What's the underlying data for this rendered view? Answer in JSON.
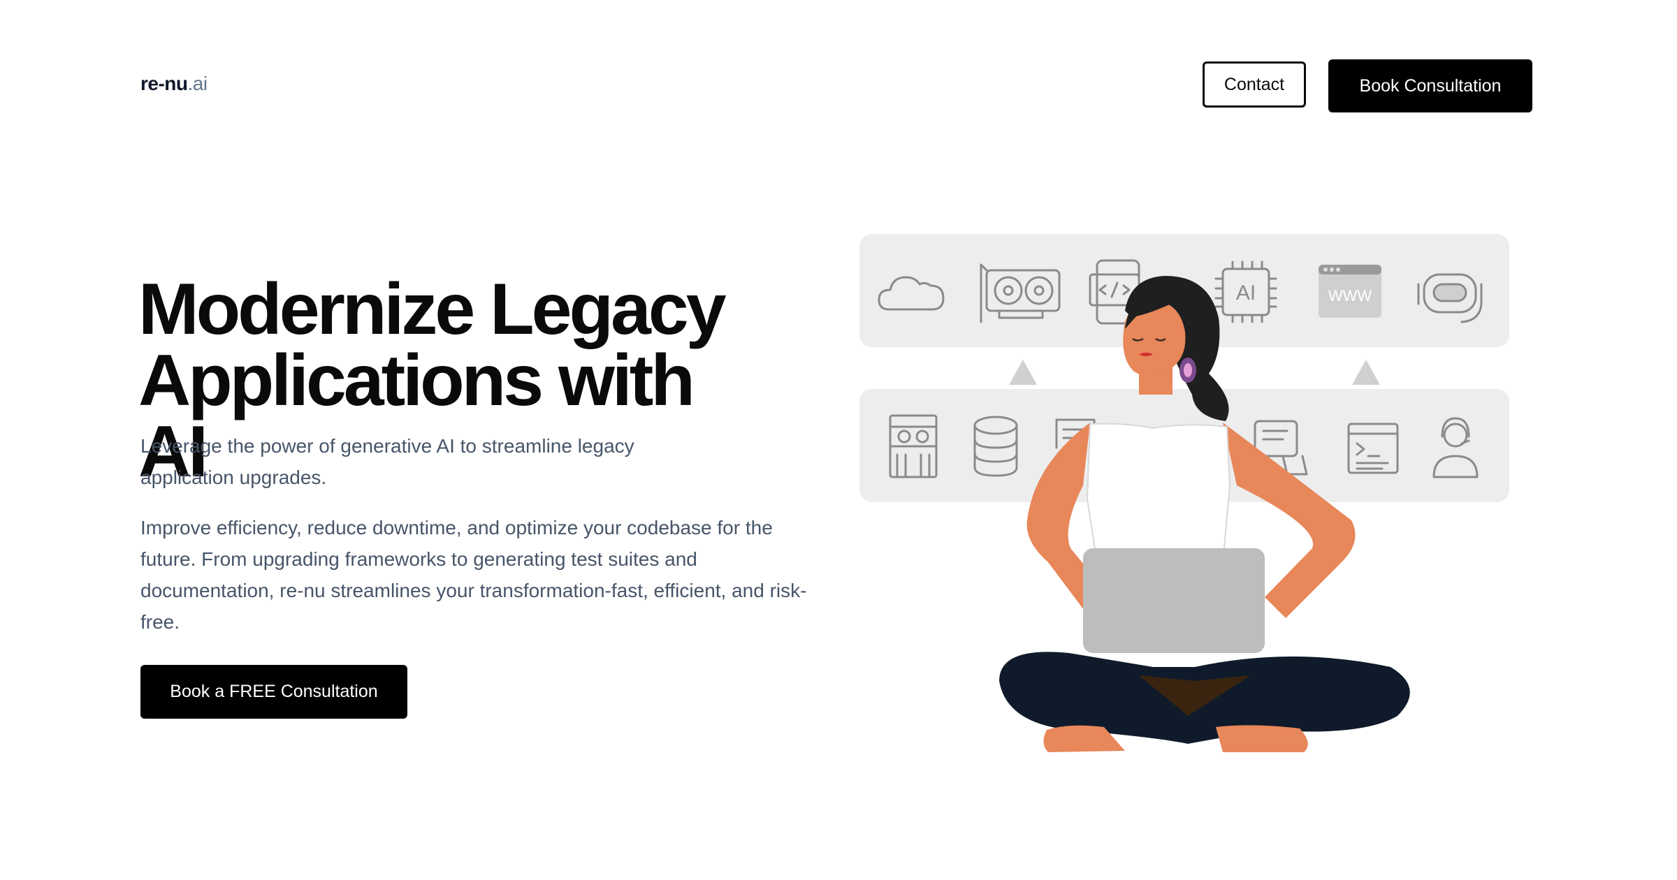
{
  "header": {
    "logo_main": "re-nu",
    "logo_suffix": ".ai",
    "contact_label": "Contact",
    "book_label": "Book Consultation"
  },
  "hero": {
    "title_line1": "Modernize Legacy",
    "title_line2": "Applications with AI",
    "subtitle": "Leverage the power of generative AI to streamline legacy application upgrades.",
    "description": "Improve efficiency, reduce downtime, and optimize your codebase for the future. From upgrading frameworks to generating test suites and documentation, re-nu streamlines your transformation-fast, efficient, and risk-free.",
    "cta_label": "Book a FREE Consultation"
  },
  "illustration": {
    "top_row_icons": [
      "cloud-icon",
      "gpu-card-icon",
      "mobile-code-icon",
      "ai-chip-icon",
      "www-browser-icon",
      "robot-headset-icon"
    ],
    "bottom_row_icons": [
      "server-rack-icon",
      "database-icon",
      "document-icon",
      "legacy-computer-icon",
      "terminal-window-icon",
      "support-agent-icon"
    ],
    "ai_chip_text": "AI",
    "www_text": "WWW",
    "colors": {
      "panel": "#ededed",
      "icon_stroke": "#8a8a8a",
      "skin": "#e8875a",
      "hair": "#1f1f1f",
      "shirt": "#ffffff",
      "pants": "#0f1b2a",
      "laptop": "#bdbdbd",
      "headset": "#7b4a8c"
    }
  }
}
